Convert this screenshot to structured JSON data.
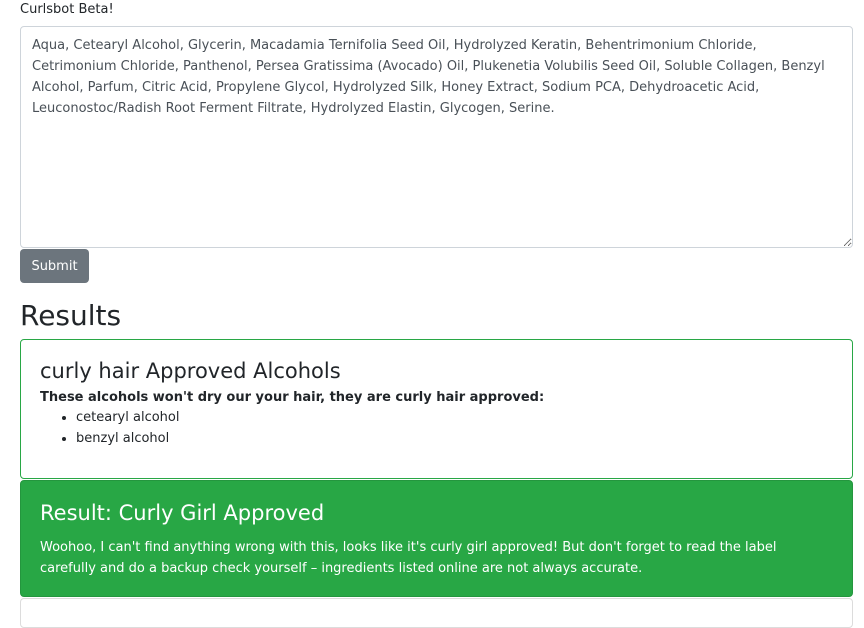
{
  "app": {
    "title": "Curlsbot Beta!"
  },
  "form": {
    "ingredients_value": "Aqua, Cetearyl Alcohol, Glycerin, Macadamia Ternifolia Seed Oil, Hydrolyzed Keratin, Behentrimonium Chloride, Cetrimonium Chloride, Panthenol, Persea Gratissima (Avocado) Oil, Plukenetia Volubilis Seed Oil, Soluble Collagen, Benzyl Alcohol, Parfum, Citric Acid, Propylene Glycol, Hydrolyzed Silk, Honey Extract, Sodium PCA, Dehydroacetic Acid, Leuconostoc/Radish Root Ferment Filtrate, Hydrolyzed Elastin, Glycogen, Serine.",
    "submit_label": "Submit"
  },
  "results": {
    "heading": "Results",
    "approved_alcohols": {
      "title": "curly hair Approved Alcohols",
      "subtitle": "These alcohols won't dry our your hair, they are curly hair approved:",
      "items": [
        "cetearyl alcohol",
        "benzyl alcohol"
      ]
    },
    "verdict": {
      "title": "Result: Curly Girl Approved",
      "text": "Woohoo, I can't find anything wrong with this, looks like it's curly girl approved! But don't forget to read the label carefully and do a backup check yourself – ingredients listed online are not always accurate."
    }
  },
  "colors": {
    "success": "#28a745",
    "secondary_button": "#6c757d"
  }
}
